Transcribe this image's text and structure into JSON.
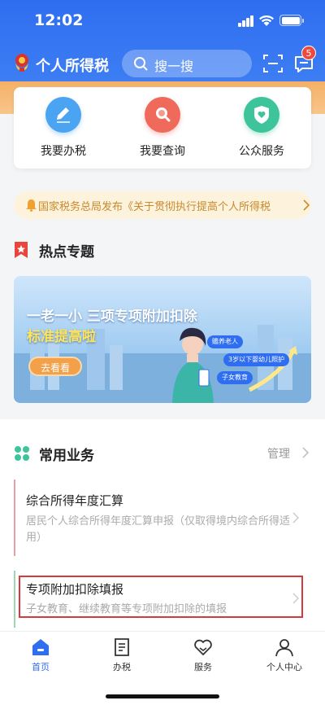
{
  "status_bar": {
    "time": "12:02"
  },
  "header": {
    "app_title": "个人所得税",
    "search_placeholder": "搜一搜",
    "message_badge": "5"
  },
  "services": [
    {
      "label": "我要办税",
      "icon": "edit-icon",
      "color": "#4aa4f2"
    },
    {
      "label": "我要查询",
      "icon": "search-icon",
      "color": "#f06a5c"
    },
    {
      "label": "公众服务",
      "icon": "heart-shield-icon",
      "color": "#3ec49a"
    }
  ],
  "notice": {
    "text": "国家税务总局发布《关于贯彻执行提高个人所得税"
  },
  "hot_topics": {
    "title": "热点专题",
    "banner": {
      "title": "一老一小 三项专项附加扣除",
      "subtitle": "标准提高啦",
      "button": "去看看",
      "tags": [
        "赡养老人",
        "3岁以下婴幼儿照护",
        "子女教育"
      ]
    }
  },
  "common_business": {
    "title": "常用业务",
    "manage": "管理",
    "items": [
      {
        "title": "综合所得年度汇算",
        "desc": "居民个人综合所得年度汇算申报（仅取得境内综合所得适用）",
        "accent": "#e8a0a8"
      },
      {
        "title": "专项附加扣除填报",
        "desc": "子女教育、继续教育等专项附加扣除的填报",
        "accent": "#9ed6b0"
      }
    ]
  },
  "tabbar": [
    {
      "label": "首页",
      "icon": "home-icon",
      "active": true
    },
    {
      "label": "办税",
      "icon": "document-icon",
      "active": false
    },
    {
      "label": "服务",
      "icon": "service-heart-icon",
      "active": false
    },
    {
      "label": "个人中心",
      "icon": "user-icon",
      "active": false
    }
  ],
  "colors": {
    "primary": "#2f6ef0",
    "notice_text": "#c98a2c",
    "highlight": "#d63a3a"
  }
}
